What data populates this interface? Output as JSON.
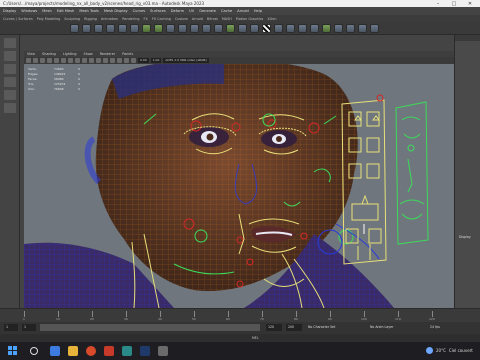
{
  "window": {
    "title": "C:/Users/.../maya/projects/modeling_nx_all_body_v2/scenes/head_rig_v03.ma - Autodesk Maya 2023"
  },
  "menubar": {
    "items": [
      "Display",
      "Windows",
      "Mesh",
      "Edit Mesh",
      "Mesh Tools",
      "Mesh Display",
      "Curves",
      "Surfaces",
      "Deform",
      "UV",
      "Generate",
      "Cache",
      "Arnold",
      "Help"
    ]
  },
  "shelf_tabs": {
    "items": [
      "Curves / Surfaces",
      "Poly Modeling",
      "Sculpting",
      "Rigging",
      "Animation",
      "Rendering",
      "FX",
      "FX Caching",
      "Custom",
      "Arnold",
      "Bifrost",
      "MASH",
      "Motion Graphics",
      "XGen"
    ]
  },
  "panel": {
    "menu": [
      "View",
      "Shading",
      "Lighting",
      "Show",
      "Renderer",
      "Panels"
    ],
    "field_a": "0.00",
    "field_b": "1.00",
    "color_space": "ACES 1.0 SDR-video (sRGB)"
  },
  "hud": {
    "rows": [
      {
        "label": "Verts:",
        "value": "74803",
        "z": "0"
      },
      {
        "label": "Edges:",
        "value": "148915",
        "z": "0"
      },
      {
        "label": "Faces:",
        "value": "58980",
        "z": "0"
      },
      {
        "label": "Tris:",
        "value": "125074",
        "z": "0"
      },
      {
        "label": "UVs:",
        "value": "76848",
        "z": "0"
      }
    ]
  },
  "right_panel": {
    "label": "Display"
  },
  "timeline": {
    "labels": [
      "1",
      "10",
      "20",
      "30",
      "40",
      "50",
      "60",
      "70",
      "80",
      "90",
      "100",
      "110",
      "120"
    ]
  },
  "range": {
    "start": "1",
    "inner_start": "1",
    "inner_end": "120",
    "end": "200",
    "character_set": "No Character Set",
    "anim_layer": "No Anim Layer",
    "fps": "24 fps"
  },
  "cmdline": {
    "label": "MEL"
  },
  "taskbar": {
    "weather_temp": "20°C",
    "weather_text": "Ciel couvert"
  },
  "colors": {
    "viewport_bg": "#6f767d",
    "skin": "#6b3f2a",
    "wire": "#e07a1a",
    "rig_yellow": "#e8e07a",
    "rig_green": "#3cdc5a",
    "rig_red": "#d22828"
  }
}
